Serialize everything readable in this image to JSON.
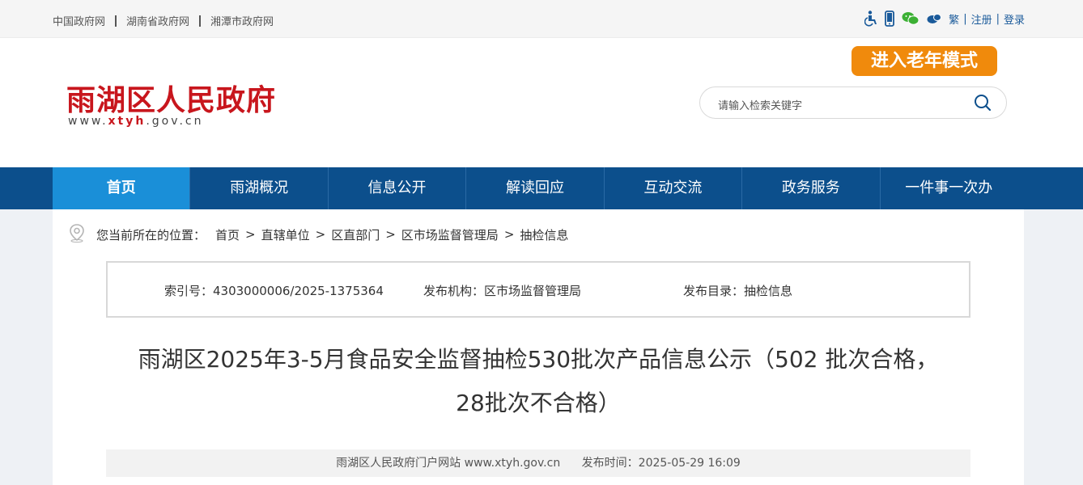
{
  "topbar": {
    "links": [
      "中国政府网",
      "湖南省政府网",
      "湘潭市政府网"
    ],
    "traditional": "繁",
    "register": "注册",
    "login": "登录",
    "icons": [
      "accessibility-icon",
      "mobile-icon",
      "wechat-icon",
      "weibo-icon"
    ]
  },
  "header": {
    "site_title": "雨湖区人民政府",
    "url_prefix": "www.",
    "url_brand": "xtyh",
    "url_suffix": ".gov.cn",
    "elder_mode": "进入老年模式",
    "search_placeholder": "请输入检索关键字"
  },
  "nav": {
    "items": [
      "首页",
      "雨湖概况",
      "信息公开",
      "解读回应",
      "互动交流",
      "政务服务",
      "一件事一次办"
    ],
    "active_index": 0
  },
  "breadcrumb": {
    "label": "您当前所在的位置：",
    "items": [
      "首页",
      "直辖单位",
      "区直部门",
      "区市场监督管理局",
      "抽检信息"
    ]
  },
  "meta": {
    "index": "索引号：4303000006/2025-1375364",
    "publisher": "发布机构：区市场监督管理局",
    "catalog": "发布目录：抽检信息"
  },
  "article": {
    "title_line1": "雨湖区2025年3-5月食品安全监督抽检530批次产品信息公示（502 批次合格，",
    "title_line2": "28批次不合格）",
    "source": "雨湖区人民政府门户网站 www.xtyh.gov.cn",
    "time": "发布时间：2025-05-29 16:09"
  },
  "colors": {
    "brand_red": "#c8161d",
    "nav_blue": "#0c4f8c",
    "nav_active": "#1a8fd8",
    "elder_orange": "#f08a0c"
  }
}
